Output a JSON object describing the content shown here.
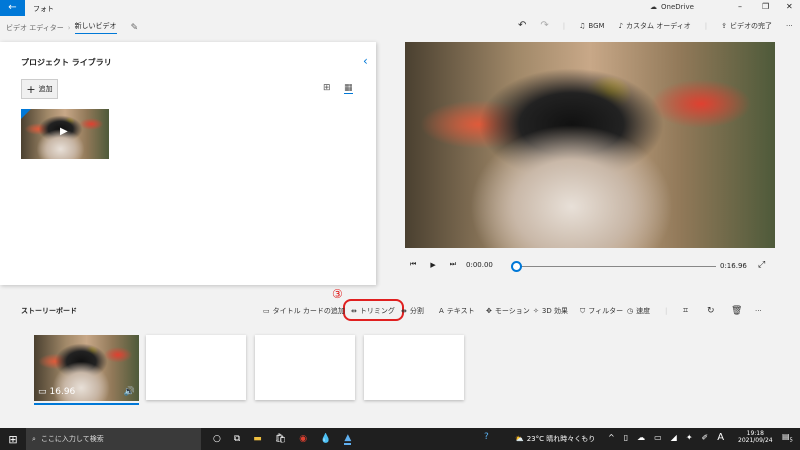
{
  "titlebar": {
    "app": "フォト",
    "onedrive": "OneDrive",
    "minimize": "–",
    "maximize": "❐",
    "close": "✕"
  },
  "breadcrumb": {
    "parent": "ビデオ エディター",
    "current": "新しいビデオ"
  },
  "toolbar": {
    "bgm": "BGM",
    "custom_audio": "カスタム オーディオ",
    "finish": "ビデオの完了",
    "more": "···"
  },
  "library": {
    "title": "プロジェクト ライブラリ",
    "add": "追加"
  },
  "player": {
    "current": "0:00.00",
    "total": "0:16.96",
    "progress": 0
  },
  "storyboard": {
    "title": "ストーリーボード",
    "actions": [
      "タイトル カードの追加",
      "トリミング",
      "分割",
      "テキスト",
      "モーション",
      "3D 効果",
      "フィルター",
      "速度"
    ],
    "clip_duration": "16.96",
    "annotation": "③",
    "more": "···"
  },
  "taskbar": {
    "search_placeholder": "ここに入力して検索",
    "weather": "23°C 晴れ時々くもり",
    "ime": "A",
    "time": "19:18",
    "date": "2021/09/24",
    "notifications": "5"
  },
  "colors": {
    "accent": "#0078d7",
    "highlight": "#e02020"
  }
}
